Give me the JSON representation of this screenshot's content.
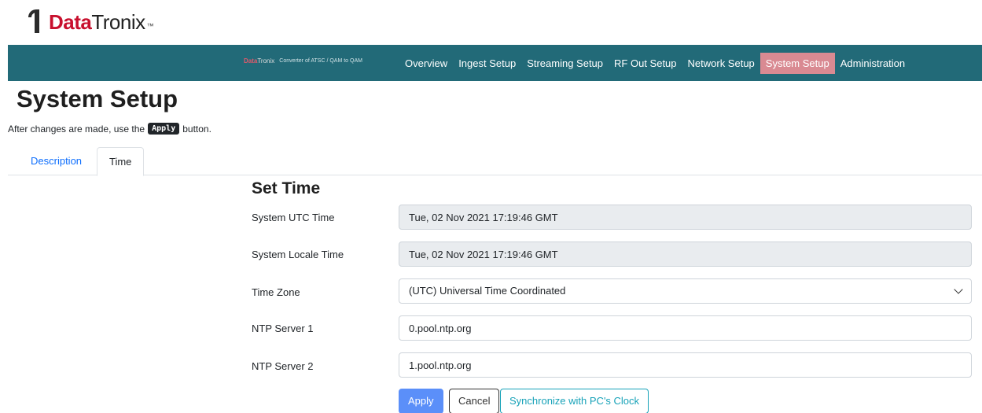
{
  "logo": {
    "data_text": "Data",
    "tronix_text": "Tronix",
    "tm": "™"
  },
  "navbar": {
    "brand_mini_data": "Data",
    "brand_mini_tronix": "Tronix",
    "brand_subtitle": "Converter of ATSC / QAM to QAM",
    "links": [
      {
        "label": "Overview"
      },
      {
        "label": "Ingest Setup"
      },
      {
        "label": "Streaming Setup"
      },
      {
        "label": "RF Out Setup"
      },
      {
        "label": "Network Setup"
      },
      {
        "label": "System Setup"
      },
      {
        "label": "Administration"
      }
    ],
    "active_link": "System Setup",
    "color": "#226a78",
    "active_color": "#d98a92"
  },
  "page": {
    "title": "System Setup",
    "hint_before": "After changes are made, use the",
    "hint_code": "Apply",
    "hint_after": "button."
  },
  "tabs": [
    {
      "label": "Description",
      "active": false
    },
    {
      "label": "Time",
      "active": true
    }
  ],
  "form": {
    "section_title": "Set Time",
    "fields": {
      "utc_time": {
        "label": "System UTC Time",
        "value": "Tue, 02 Nov 2021 17:19:46 GMT"
      },
      "locale_time": {
        "label": "System Locale Time",
        "value": "Tue, 02 Nov 2021 17:19:46 GMT"
      },
      "time_zone": {
        "label": "Time Zone",
        "value": "(UTC) Universal Time Coordinated"
      },
      "ntp1": {
        "label": "NTP Server 1",
        "value": "0.pool.ntp.org"
      },
      "ntp2": {
        "label": "NTP Server 2",
        "value": "1.pool.ntp.org"
      }
    }
  },
  "buttons": {
    "apply": "Apply",
    "cancel": "Cancel",
    "sync": "Synchronize with PC's Clock"
  },
  "icons": {
    "select_caret": "chevron-down-icon",
    "logo": "datatronix-logo-icon"
  }
}
